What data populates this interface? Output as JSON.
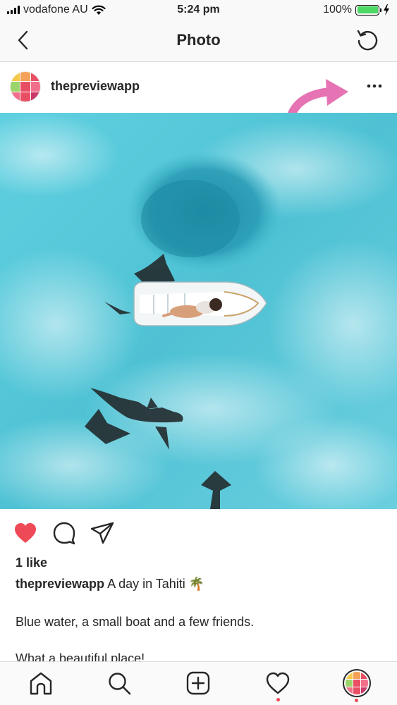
{
  "status_bar": {
    "carrier": "vodafone AU",
    "time": "5:24 pm",
    "battery_percent": "100%",
    "battery_level": 1.0
  },
  "header": {
    "title": "Photo",
    "back_icon": "chevron-left-icon",
    "refresh_icon": "refresh-icon"
  },
  "post": {
    "username": "thepreviewapp",
    "more_icon": "more-horizontal-icon",
    "liked": true,
    "likes_text": "1 like",
    "caption_user": "thepreviewapp",
    "caption_text": "A day in Tahiti 🌴",
    "caption_line2": "Blue water, a small boat and a few friends.",
    "caption_line3": "What a beautiful place!"
  },
  "avatar_colors": [
    "#f7c948",
    "#f4a259",
    "#e94f64",
    "#9bd46b",
    "#e94f64",
    "#f06f8a",
    "#f06f8a",
    "#e94f64",
    "#c93a6b"
  ],
  "colors": {
    "like_red": "#ed4956",
    "annotation_pink": "#e673b4",
    "water": "#4fc3d4"
  },
  "tab_bar": {
    "items": [
      "home-icon",
      "search-icon",
      "new-post-icon",
      "activity-heart-icon",
      "profile-avatar"
    ]
  }
}
